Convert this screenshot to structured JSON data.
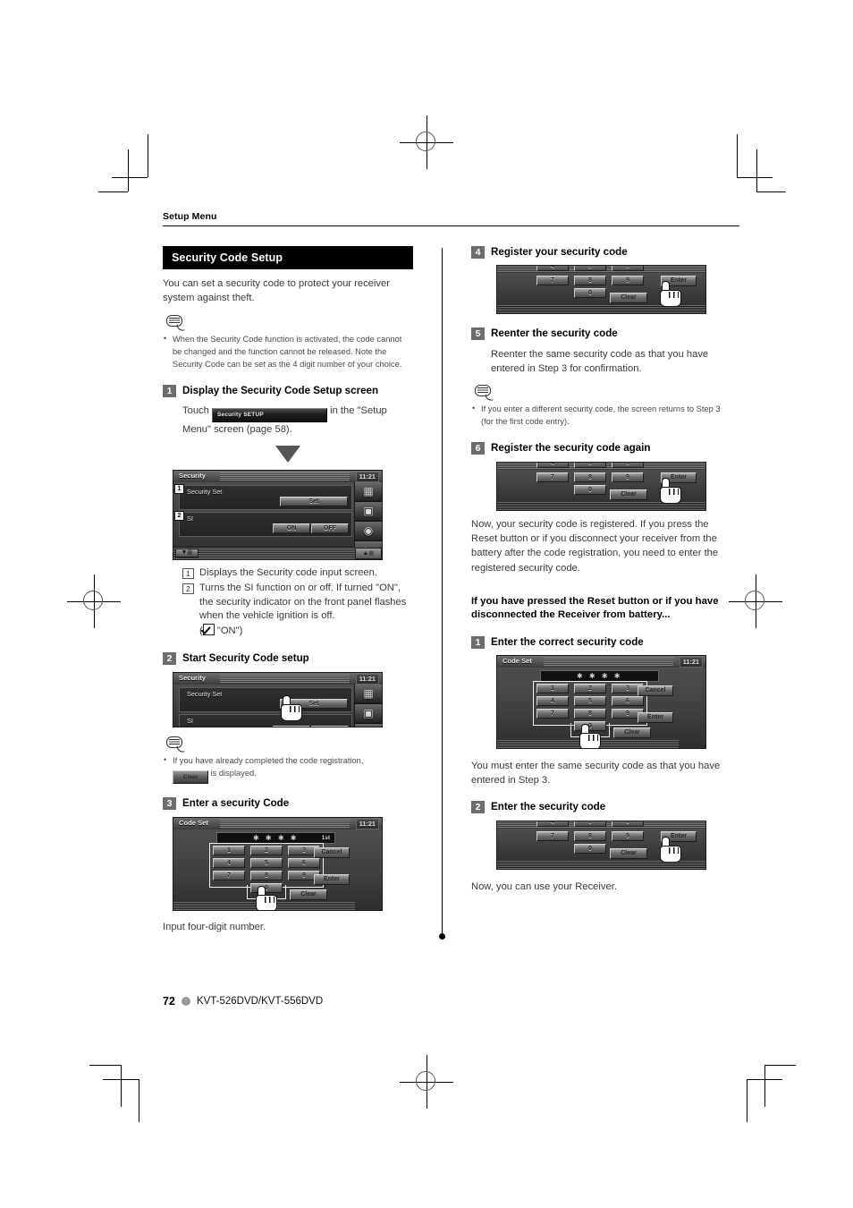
{
  "running_head": "Setup Menu",
  "section": {
    "title": "Security Code Setup",
    "intro": "You can set a security code to protect your receiver system against theft."
  },
  "notes": {
    "note1": "When the Security Code function is activated, the code cannot be changed and the function cannot be released. Note the Security Code can be set as the 4 digit number of your choice.",
    "note2": "If you have already completed the code registration,",
    "note2_tail": "is displayed.",
    "note2_button": "Clear",
    "note3": "If you enter a different security code, the screen returns to Step 3 (for the first code entry)."
  },
  "left_column": {
    "step1": {
      "num": "1",
      "title": "Display the Security Code Setup screen",
      "body_pre": "Touch",
      "button_label": "Security SETUP",
      "body_post": "in the \"Setup Menu\" screen (page 58)."
    },
    "security_screen": {
      "title": "Security",
      "clock": "11:21",
      "row1_num": "1",
      "row1_label": "Security Set",
      "row1_button": "Set",
      "row2_num": "2",
      "row2_label": "SI",
      "row2_button_on": "ON",
      "row2_button_off": "OFF"
    },
    "callouts": [
      {
        "num": "1",
        "text": "Displays the Security code input screen."
      },
      {
        "num": "2",
        "text": "Turns the SI function on or off. If turned \"ON\", the security indicator on the front panel flashes when the vehicle ignition is off."
      }
    ],
    "callout2_default_pre": "(",
    "callout2_default": "\"ON\")",
    "step2": {
      "num": "2",
      "title": "Start Security Code setup"
    },
    "step3": {
      "num": "3",
      "title": "Enter a security Code",
      "caption": "Input four-digit number."
    },
    "code_set_screen": {
      "title": "Code Set",
      "clock": "11:21",
      "stars": "✱ ✱ ✱ ✱",
      "ordinal": "1st",
      "keys": [
        [
          "1",
          "2",
          "3"
        ],
        [
          "4",
          "5",
          "6"
        ],
        [
          "7",
          "8",
          "9"
        ]
      ],
      "key_zero": "0",
      "cancel": "Cancel",
      "enter": "Enter",
      "clear": "Clear"
    }
  },
  "right_column": {
    "step4": {
      "num": "4",
      "title": "Register your security code"
    },
    "step5": {
      "num": "5",
      "title": "Reenter the security code",
      "body": "Reenter the same security code as that you have entered in Step 3 for confirmation."
    },
    "step6": {
      "num": "6",
      "title": "Register the security code again",
      "body": "Now, your security code is registered. If you press the Reset button or if you disconnect your receiver from the battery after the code registration, you need to enter the registered security code."
    },
    "reset_heading": "If you have pressed the Reset button or if you have disconnected the Receiver from battery...",
    "reset_step1": {
      "num": "1",
      "title": "Enter the correct security code",
      "body": "You must enter the same security code as that you have entered in Step 3."
    },
    "reset_step2": {
      "num": "2",
      "title": "Enter the security code",
      "body": "Now, you can use your Receiver."
    },
    "code_set_screen2": {
      "title": "Code Set",
      "clock": "11:21",
      "stars": "✱ ✱ ✱ ✱",
      "keys": [
        [
          "1",
          "2",
          "3"
        ],
        [
          "4",
          "5",
          "6"
        ],
        [
          "7",
          "8",
          "9"
        ]
      ],
      "key_zero": "0",
      "cancel": "Cancel",
      "enter": "Enter",
      "clear": "Clear"
    },
    "crop_keys": [
      "7",
      "8",
      "9"
    ],
    "crop_zero": "0",
    "crop_enter": "Enter",
    "crop_clear": "Clear"
  },
  "footer": {
    "page_number": "72",
    "model": "KVT-526DVD/KVT-556DVD"
  }
}
